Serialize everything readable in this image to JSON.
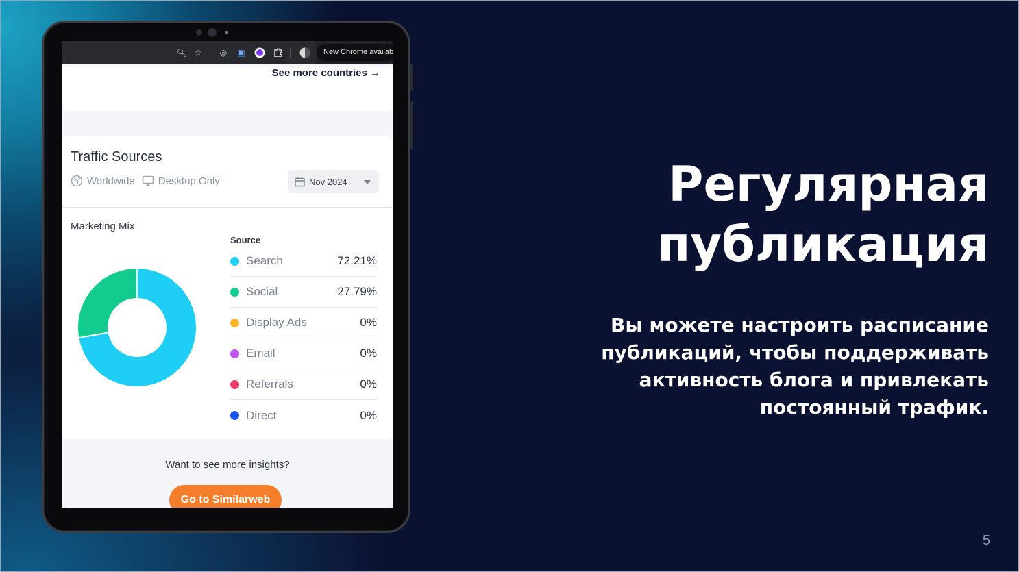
{
  "browser": {
    "notification": "New Chrome available"
  },
  "widget": {
    "see_more": "See more countries →",
    "title": "Traffic Sources",
    "region": "Worldwide",
    "device": "Desktop Only",
    "date": "Nov 2024",
    "section_label": "Marketing Mix",
    "source_header": "Source",
    "sources": [
      {
        "name": "Search",
        "value": "72.21%",
        "percent": 72.21,
        "color": "#1ecef5"
      },
      {
        "name": "Social",
        "value": "27.79%",
        "percent": 27.79,
        "color": "#12cc8f"
      },
      {
        "name": "Display Ads",
        "value": "0%",
        "percent": 0,
        "color": "#fdb22a"
      },
      {
        "name": "Email",
        "value": "0%",
        "percent": 0,
        "color": "#c255f0"
      },
      {
        "name": "Referrals",
        "value": "0%",
        "percent": 0,
        "color": "#f2396b"
      },
      {
        "name": "Direct",
        "value": "0%",
        "percent": 0,
        "color": "#1a57f2"
      }
    ],
    "insights_text": "Want to see more insights?",
    "cta_label": "Go to Similarweb"
  },
  "slide": {
    "title_line1": "Регулярная",
    "title_line2": "публикация",
    "subtitle_lines": [
      "Вы можете настроить расписание",
      "публикаций, чтобы поддерживать",
      "активность блога и привлекать",
      "постоянный трафик."
    ],
    "page_number": "5"
  },
  "colors": {
    "accent": "#f47e2b",
    "background": "#0b1130"
  }
}
